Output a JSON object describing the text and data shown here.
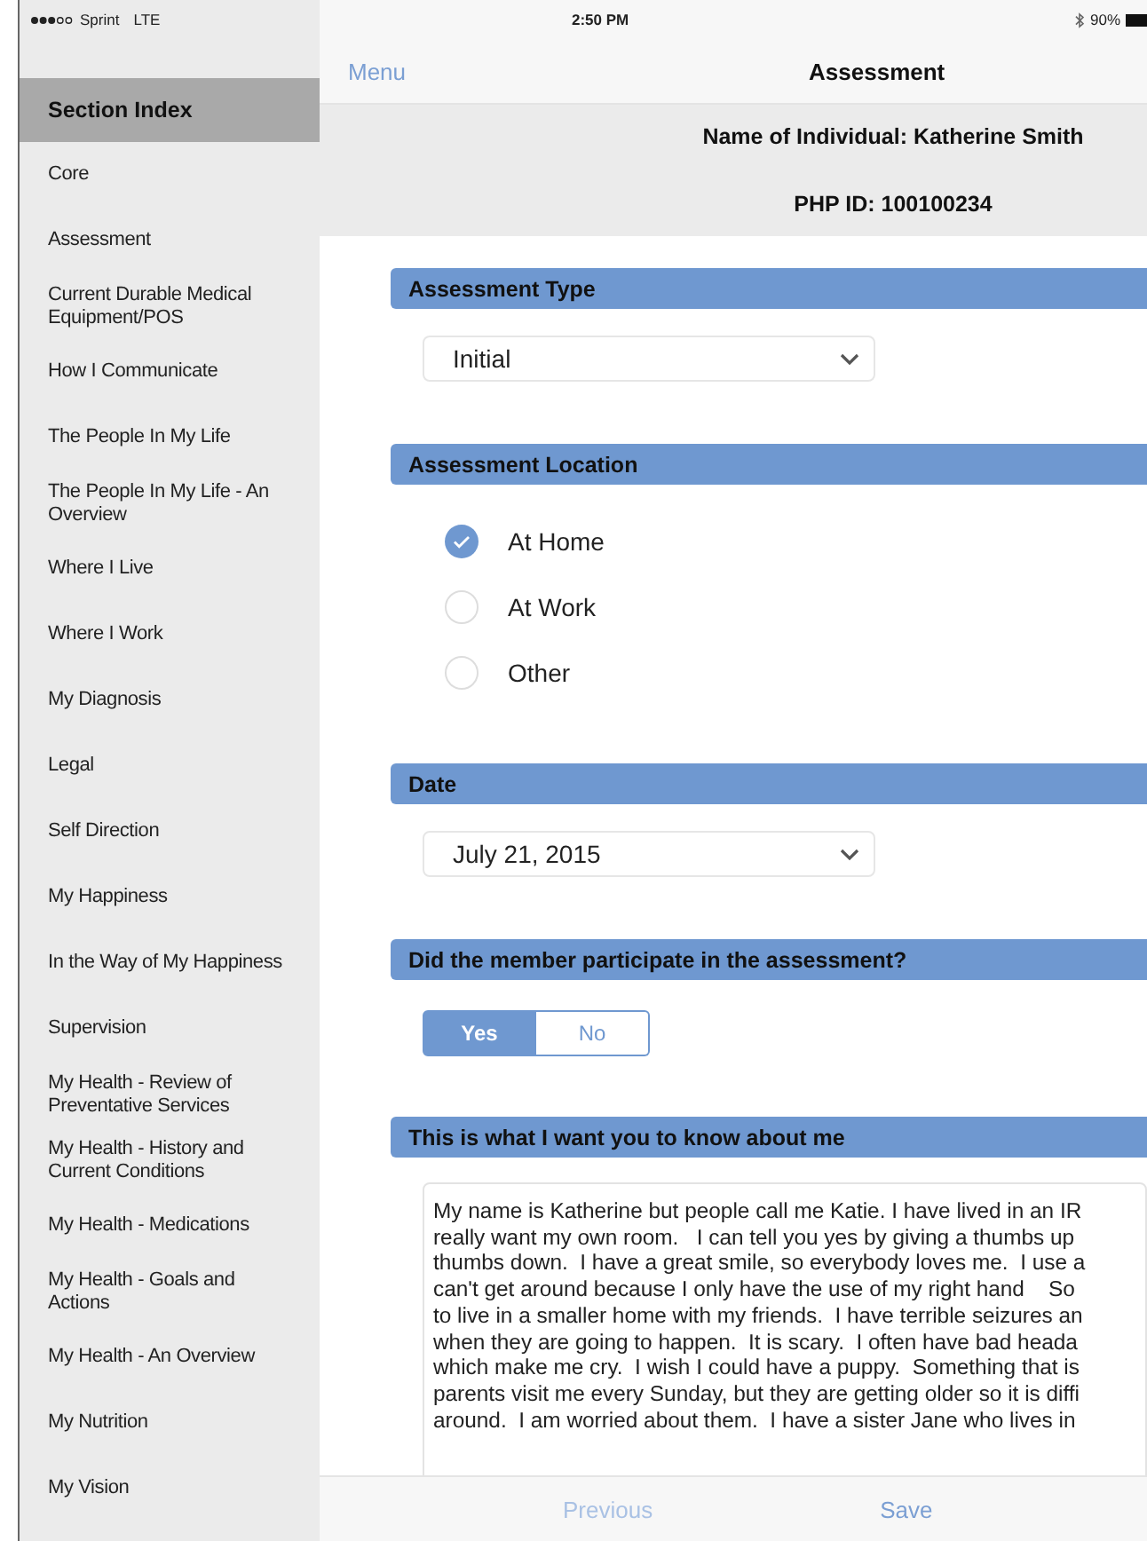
{
  "status_bar": {
    "carrier": "Sprint",
    "network": "LTE",
    "time": "2:50 PM",
    "battery": "90%"
  },
  "sidebar": {
    "title": "Section Index",
    "items": [
      {
        "label": "Core"
      },
      {
        "label": "Assessment"
      },
      {
        "label": "Current Durable Medical Equipment/POS"
      },
      {
        "label": "How I Communicate"
      },
      {
        "label": "The People In My Life"
      },
      {
        "label": "The People In My Life - An Overview"
      },
      {
        "label": "Where I Live"
      },
      {
        "label": "Where I Work"
      },
      {
        "label": "My Diagnosis"
      },
      {
        "label": "Legal"
      },
      {
        "label": "Self Direction"
      },
      {
        "label": "My Happiness"
      },
      {
        "label": "In the Way of My Happiness"
      },
      {
        "label": "Supervision"
      },
      {
        "label": "My Health - Review of Preventative Services"
      },
      {
        "label": "My Health - History and Current Conditions"
      },
      {
        "label": "My Health - Medications"
      },
      {
        "label": "My Health - Goals and Actions"
      },
      {
        "label": "My Health - An Overview"
      },
      {
        "label": "My Nutrition"
      },
      {
        "label": "My Vision"
      }
    ]
  },
  "nav_bar": {
    "menu_button": "Menu",
    "title": "Assessment"
  },
  "header": {
    "individual": "Name of Individual: Katherine Smith",
    "php_id": "PHP ID: 100100234"
  },
  "sections": [
    {
      "kind": "select",
      "title": "Assessment Type",
      "value": "Initial"
    },
    {
      "kind": "radio",
      "title": "Assessment Location",
      "options": [
        {
          "label": "At Home",
          "selected": true
        },
        {
          "label": "At Work",
          "selected": false
        },
        {
          "label": "Other",
          "selected": false
        }
      ]
    },
    {
      "kind": "select",
      "title": "Date",
      "value": "July 21, 2015"
    },
    {
      "kind": "segmented",
      "title": "Did the member participate in the assessment?",
      "options": [
        {
          "label": "Yes",
          "selected": true
        },
        {
          "label": "No",
          "selected": false
        }
      ]
    },
    {
      "kind": "textarea",
      "title": "This is what I want you to know about me",
      "lines": [
        "My name is Katherine but people call me Katie. I have lived in an IR",
        "really want my own room.   I can tell you yes by giving a thumbs up",
        "thumbs down.  I have a great smile, so everybody loves me.  I use a",
        "can't get around because I only have the use of my right hand    So",
        "to live in a smaller home with my friends.  I have terrible seizures an",
        "when they are going to happen.  It is scary.  I often have bad heada",
        "which make me cry.  I wish I could have a puppy.  Something that is",
        "parents visit me every Sunday, but they are getting older so it is diffi",
        "around.  I am worried about them.  I have a sister Jane who lives in"
      ]
    }
  ],
  "bottom_bar": {
    "buttons": [
      "Previous",
      "Save"
    ]
  }
}
